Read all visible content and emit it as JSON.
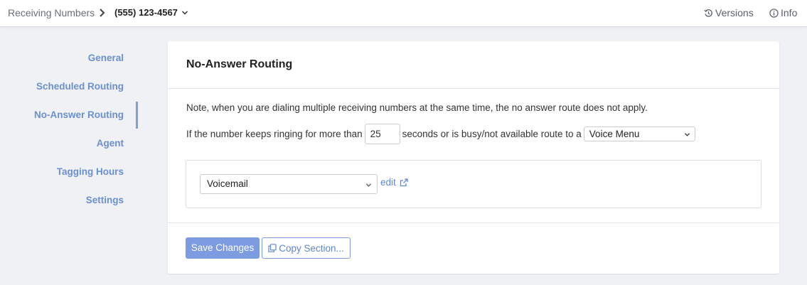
{
  "header": {
    "breadcrumb_root": "Receiving Numbers",
    "current_number": "(555) 123-4567",
    "versions_label": "Versions",
    "info_label": "Info"
  },
  "sidebar": {
    "items": [
      {
        "label": "General"
      },
      {
        "label": "Scheduled Routing"
      },
      {
        "label": "No-Answer Routing",
        "active": true
      },
      {
        "label": "Agent"
      },
      {
        "label": "Tagging Hours"
      },
      {
        "label": "Settings"
      }
    ]
  },
  "main": {
    "title": "No-Answer Routing",
    "note": "Note, when you are dialing multiple receiving numbers at the same time, the no answer route does not apply.",
    "ring_prefix": "If the number keeps ringing for more than",
    "ring_seconds": "25",
    "ring_suffix": "seconds or is busy/not available route to a",
    "route_type": "Voice Menu",
    "destination": "Voicemail",
    "edit_label": "edit",
    "save_label": "Save Changes",
    "copy_label": "Copy Section..."
  },
  "colors": {
    "accent": "#7d9be0",
    "link": "#5d86cf",
    "sidebar_text": "#6b8fd0",
    "background": "#f0f1f5"
  },
  "icons": [
    "chevron-right-icon",
    "chevron-down-icon",
    "history-icon",
    "info-icon",
    "external-link-icon",
    "copy-icon"
  ]
}
